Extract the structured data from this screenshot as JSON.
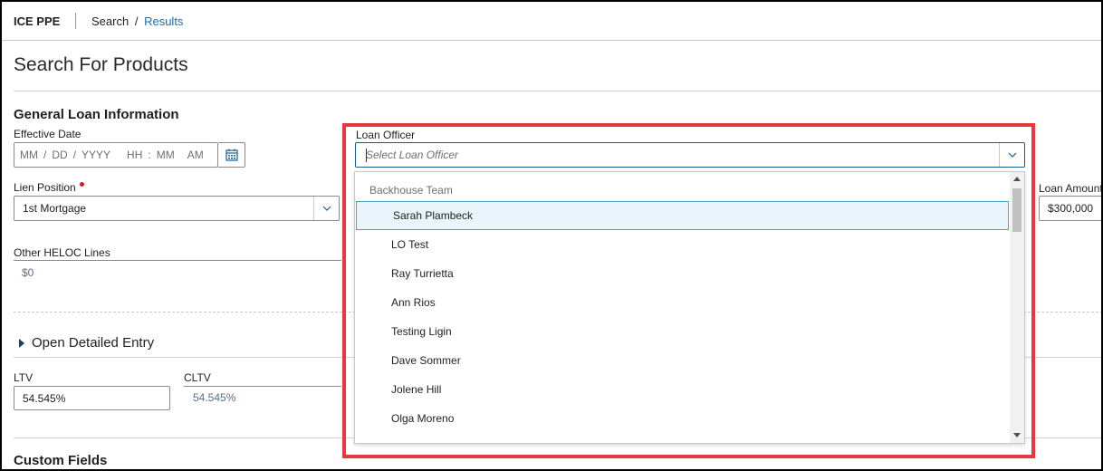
{
  "header": {
    "app_name": "ICE PPE",
    "breadcrumb": {
      "search": "Search",
      "separator": "/",
      "results": "Results"
    }
  },
  "page": {
    "title": "Search For Products"
  },
  "general": {
    "section_title": "General Loan Information",
    "effective_date": {
      "label": "Effective Date",
      "mm": "MM",
      "sep1": "/",
      "dd": "DD",
      "sep2": "/",
      "yyyy": "YYYY",
      "hh": "HH",
      "colon": ":",
      "min": "MM",
      "ampm": "AM",
      "icon": "calendar-icon"
    },
    "lien_position": {
      "label": "Lien Position",
      "value": "1st Mortgage",
      "required": true
    },
    "other_heloc": {
      "label": "Other HELOC Lines",
      "value": "$0"
    },
    "loan_amount": {
      "label": "Loan Amount",
      "value": "$300,000"
    },
    "loan_officer": {
      "label": "Loan Officer",
      "placeholder": "Select Loan Officer",
      "group": "Backhouse Team",
      "options": [
        "Sarah Plambeck",
        "LO Test",
        "Ray Turrietta",
        "Ann Rios",
        "Testing Ligin",
        "Dave Sommer",
        "Jolene Hill",
        "Olga Moreno"
      ],
      "highlighted": "Sarah Plambeck"
    }
  },
  "detailed_entry": {
    "label": "Open Detailed Entry"
  },
  "ratios": {
    "ltv": {
      "label": "LTV",
      "value": "54.545%"
    },
    "cltv": {
      "label": "CLTV",
      "value": "54.545%"
    }
  },
  "custom_fields": {
    "section_title": "Custom Fields"
  },
  "colors": {
    "accent": "#1a6fb5",
    "highlight_border": "#e8373f",
    "selected_row": "#eaf4fb",
    "required": "#d11a2a"
  }
}
